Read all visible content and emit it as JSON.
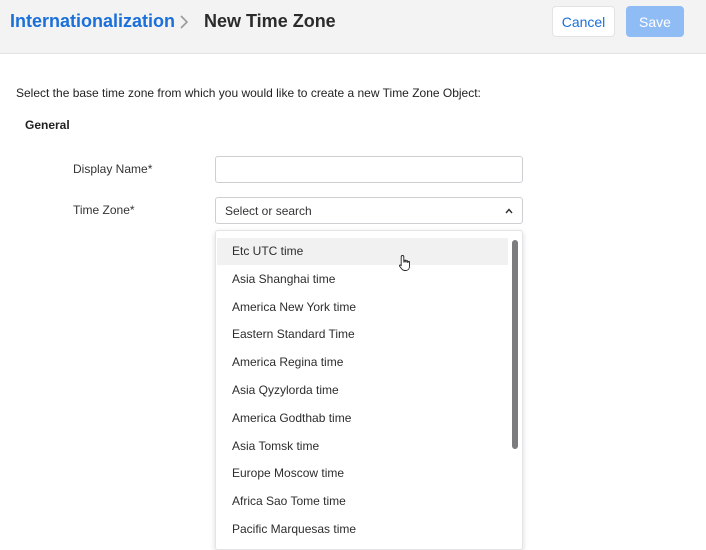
{
  "header": {
    "breadcrumb_parent": "Internationalization",
    "title": "New Time Zone",
    "cancel_label": "Cancel",
    "save_label": "Save"
  },
  "form": {
    "intro": "Select the base time zone from which you would like to create a new Time Zone Object:",
    "section_title": "General",
    "display_name_label": "Display Name*",
    "display_name_value": "",
    "time_zone_label": "Time Zone*",
    "time_zone_placeholder": "Select or search"
  },
  "dropdown": {
    "hovered_index": 0,
    "options": [
      "Etc UTC time",
      "Asia Shanghai time",
      "America New York time",
      "Eastern Standard Time",
      "America Regina time",
      "Asia Qyzylorda time",
      "America Godthab time",
      "Asia Tomsk time",
      "Europe Moscow time",
      "Africa Sao Tome time",
      "Pacific Marquesas time"
    ]
  },
  "colors": {
    "accent": "#1a6fd9",
    "save_disabled": "#8fbcf5",
    "header_bg": "#f3f3f4"
  },
  "icons": {
    "breadcrumb_separator": "chevron-right-icon",
    "select_toggle": "chevron-up-icon",
    "pointer": "hand-cursor-icon"
  }
}
